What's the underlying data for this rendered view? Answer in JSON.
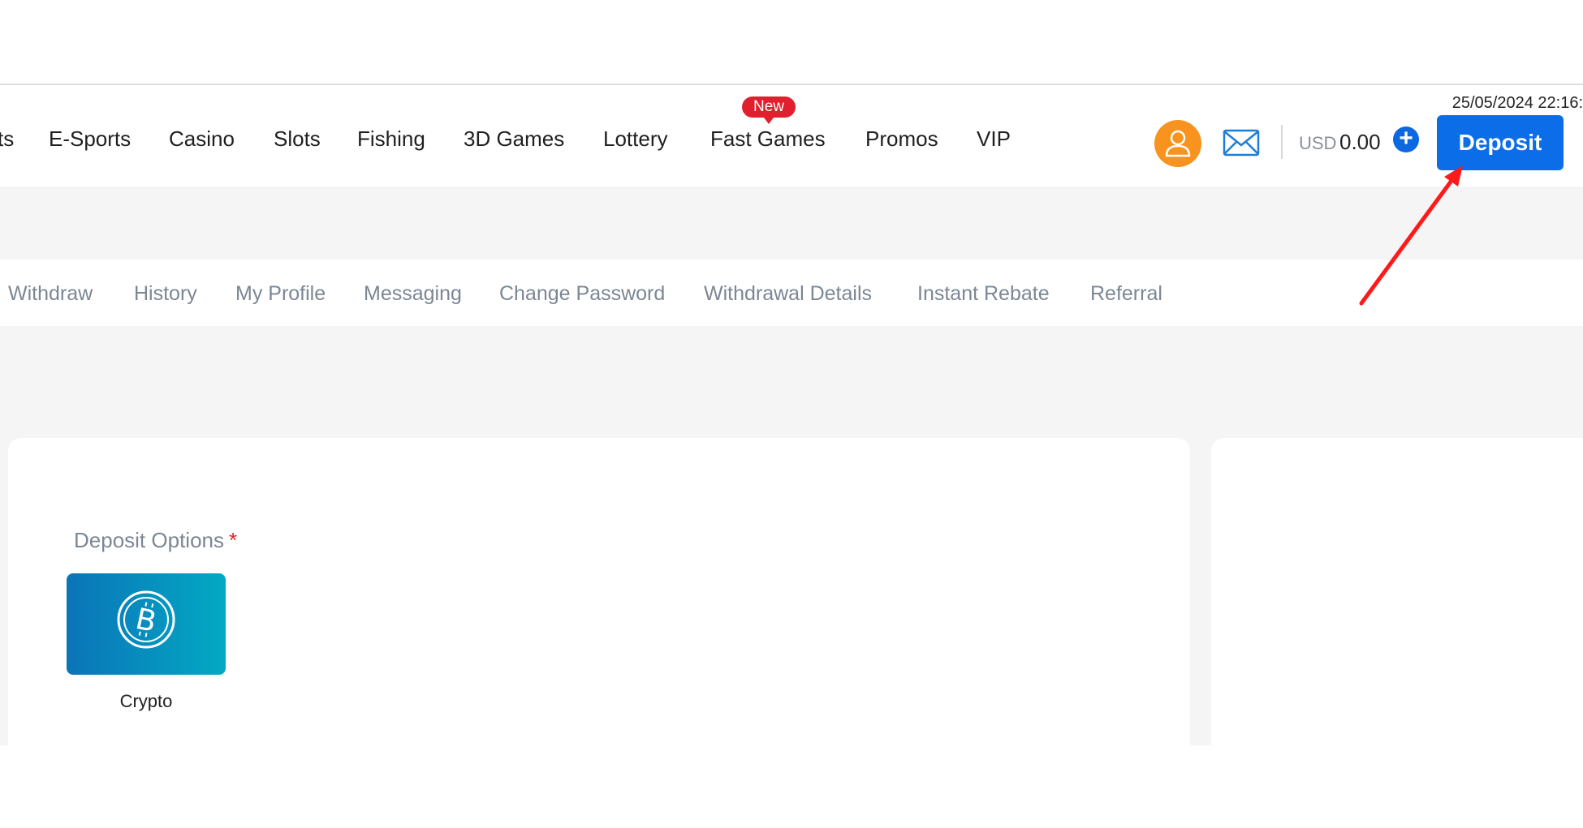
{
  "header": {
    "datetime": "25/05/2024 22:16:",
    "nav": [
      {
        "label": "ts"
      },
      {
        "label": "E-Sports"
      },
      {
        "label": "Casino"
      },
      {
        "label": "Slots"
      },
      {
        "label": "Fishing"
      },
      {
        "label": "3D Games"
      },
      {
        "label": "Lottery"
      },
      {
        "label": "Fast Games"
      },
      {
        "label": "Promos"
      },
      {
        "label": "VIP"
      }
    ],
    "new_badge": "New",
    "currency": "USD",
    "balance": "0.00",
    "deposit_label": "Deposit"
  },
  "subnav": [
    {
      "label": "Withdraw"
    },
    {
      "label": "History"
    },
    {
      "label": "My Profile"
    },
    {
      "label": "Messaging"
    },
    {
      "label": "Change Password"
    },
    {
      "label": "Withdrawal Details"
    },
    {
      "label": "Instant Rebate"
    },
    {
      "label": "Referral"
    }
  ],
  "main": {
    "options_label": "Deposit Options",
    "required_mark": "*",
    "crypto_label": "Crypto"
  },
  "colors": {
    "accent": "#0b6ee8",
    "badge": "#e0202e",
    "avatar": "#f7931e",
    "annotation_arrow": "#ff0000"
  }
}
